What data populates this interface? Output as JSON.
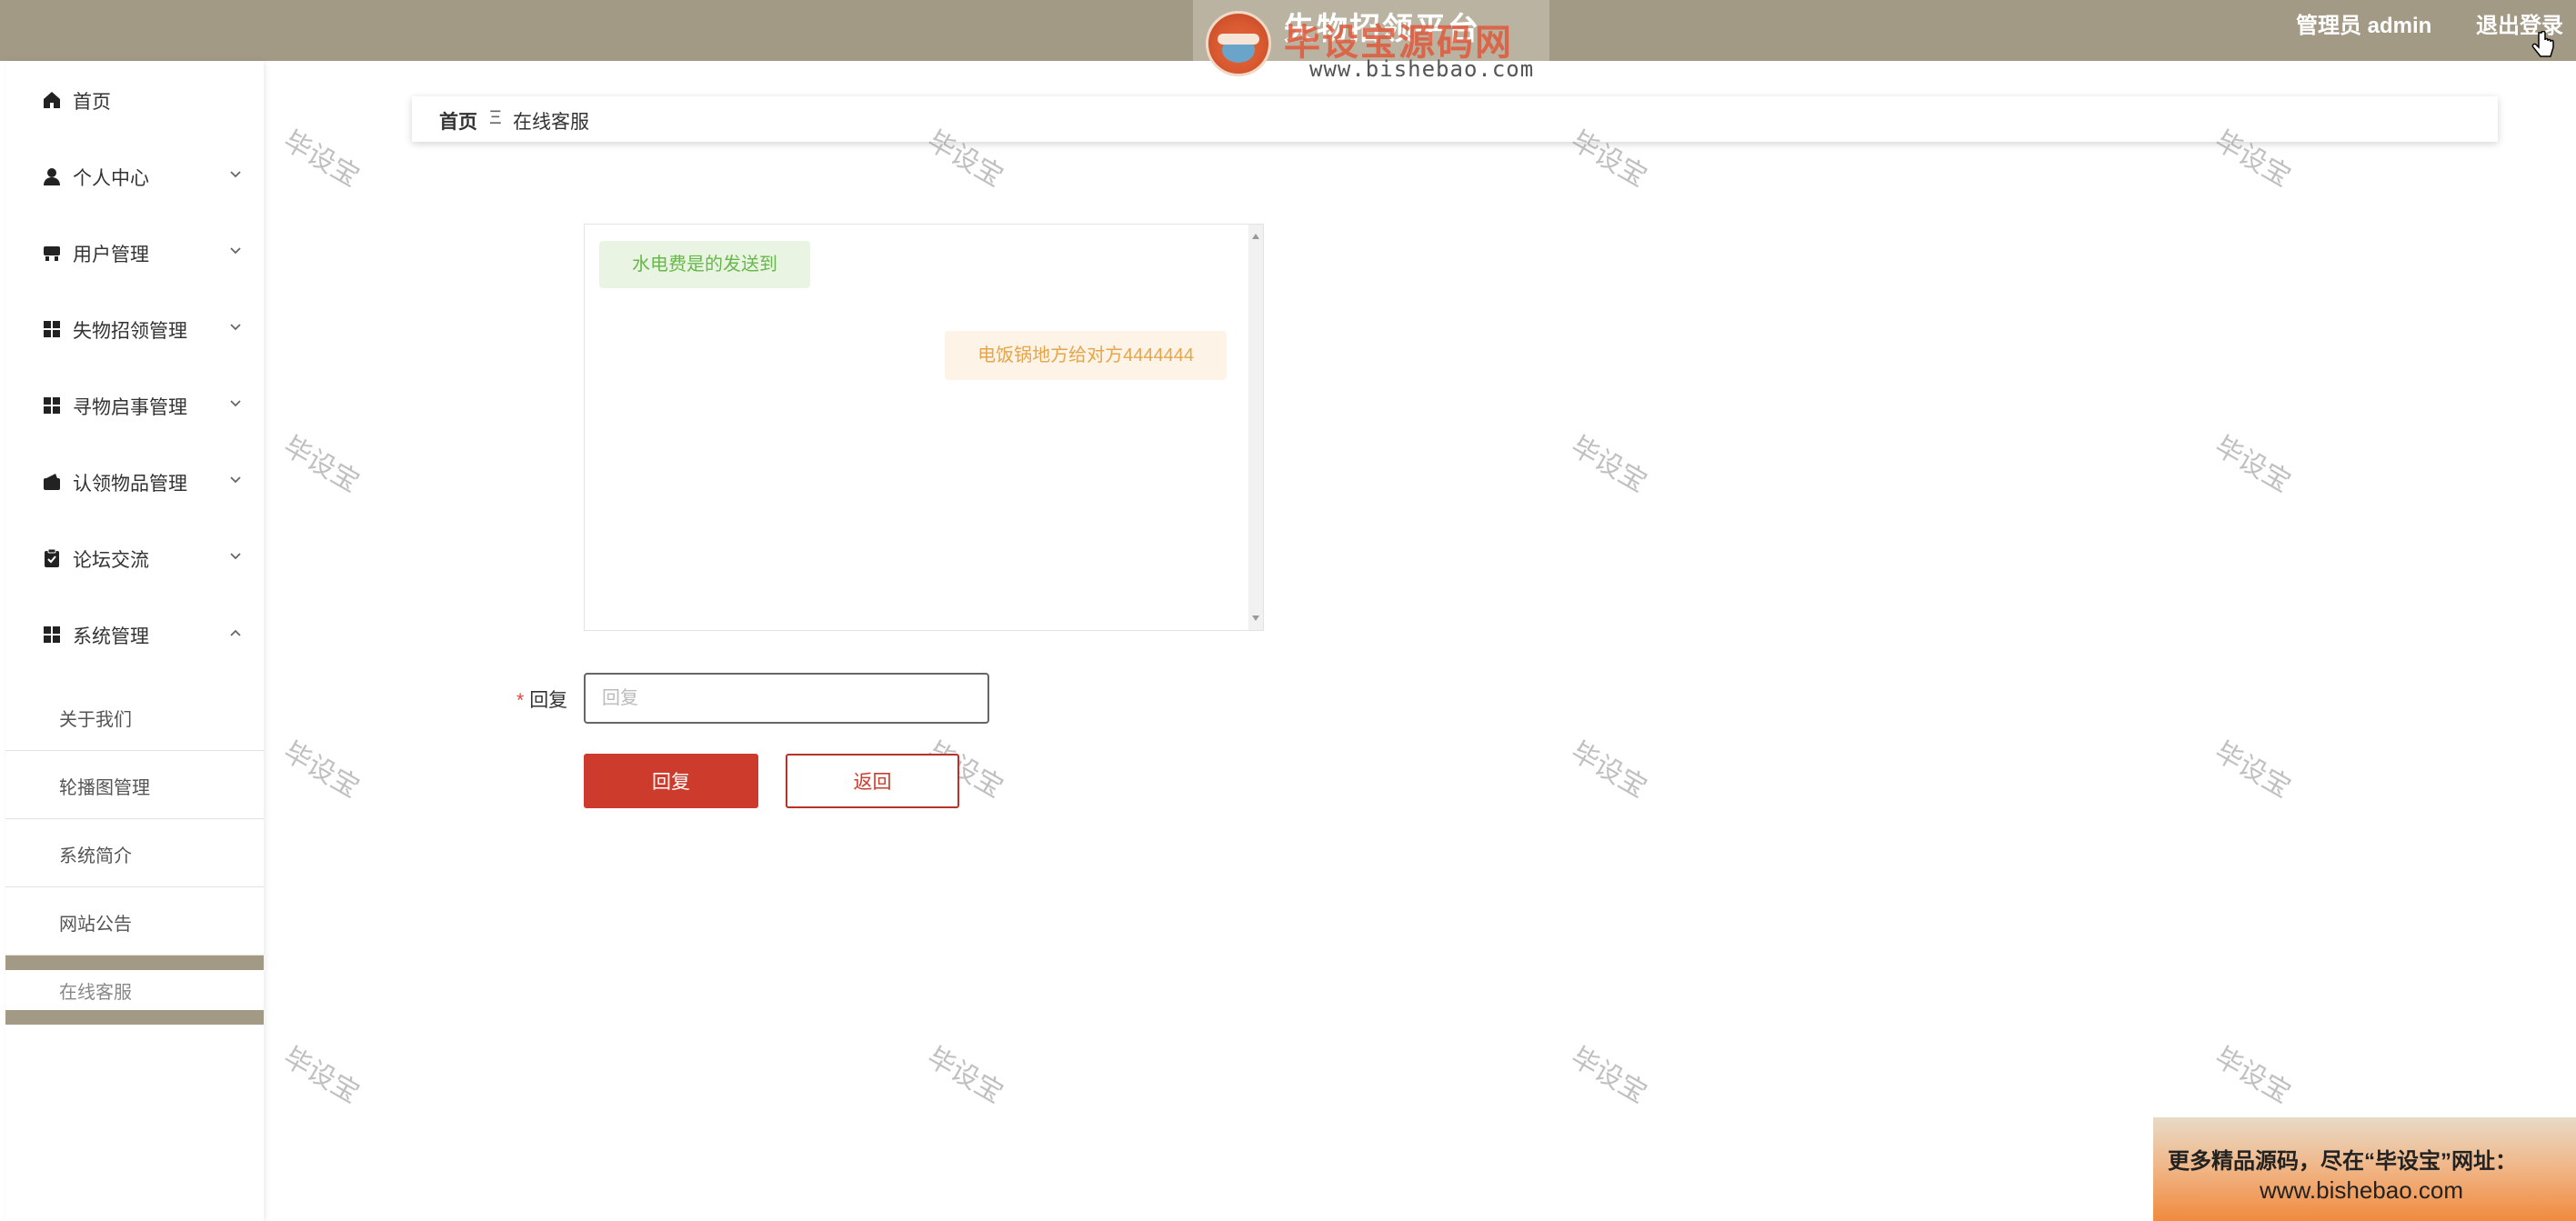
{
  "header": {
    "site_title": "失物招领平台",
    "logo_wm_text": "毕设宝源码网",
    "logo_wm_url": "www.bishebao.com",
    "admin_label": "管理员 admin",
    "logout_label": "退出登录",
    "bg_color": "#a39a86"
  },
  "sidebar": {
    "items": [
      {
        "label": "首页",
        "icon": "home-icon"
      },
      {
        "label": "个人中心",
        "icon": "person-icon"
      },
      {
        "label": "用户管理",
        "icon": "user-manage-icon"
      },
      {
        "label": "失物招领管理",
        "icon": "grid-icon"
      },
      {
        "label": "寻物启事管理",
        "icon": "grid-icon"
      },
      {
        "label": "认领物品管理",
        "icon": "wallet-icon"
      },
      {
        "label": "论坛交流",
        "icon": "clipboard-icon"
      },
      {
        "label": "系统管理",
        "icon": "grid-icon"
      }
    ],
    "sub_items": [
      "关于我们",
      "轮播图管理",
      "系统简介",
      "网站公告",
      "在线客服"
    ]
  },
  "breadcrumb": {
    "home": "首页",
    "separator": "Ξ",
    "current": "在线客服"
  },
  "chat": {
    "messages": [
      {
        "side": "left",
        "text": "水电费是的发送到"
      },
      {
        "side": "right",
        "text": "电饭锅地方给对方4444444"
      }
    ]
  },
  "form": {
    "reply_label": "回复",
    "required_mark": "*",
    "reply_placeholder": "回复",
    "reply_value": "",
    "submit_label": "回复",
    "back_label": "返回"
  },
  "watermark": {
    "text": "毕设宝"
  },
  "promo": {
    "line1": "更多精品源码，尽在“毕设宝”网址：",
    "line2": "www.bishebao.com"
  }
}
